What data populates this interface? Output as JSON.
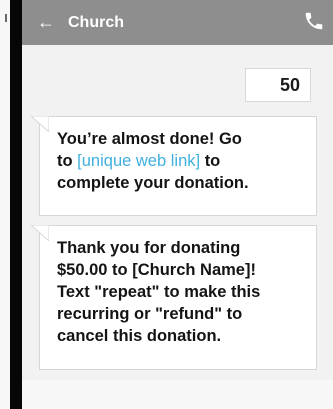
{
  "header": {
    "back_icon": "←",
    "title": "Church"
  },
  "messages": {
    "sent_amount": "50",
    "received_1": {
      "line_1": "You’re almost done! Go",
      "to_word": "to",
      "link_text": "[unique web link]",
      "after_link": "to",
      "line_3": "complete your donation."
    },
    "received_2": {
      "line_1": "Thank you for donating",
      "line_2": "$50.00 to [Church Name]!",
      "line_3": "Text \"repeat\" to make this",
      "line_4": "recurring or \"refund\" to",
      "line_5": "cancel this donation."
    }
  },
  "colors": {
    "header_bg": "#8e8e8e",
    "link": "#3fb0de",
    "background": "#f2f2f2"
  },
  "icons": {
    "back": "arrow-left-icon",
    "call": "phone-icon"
  }
}
